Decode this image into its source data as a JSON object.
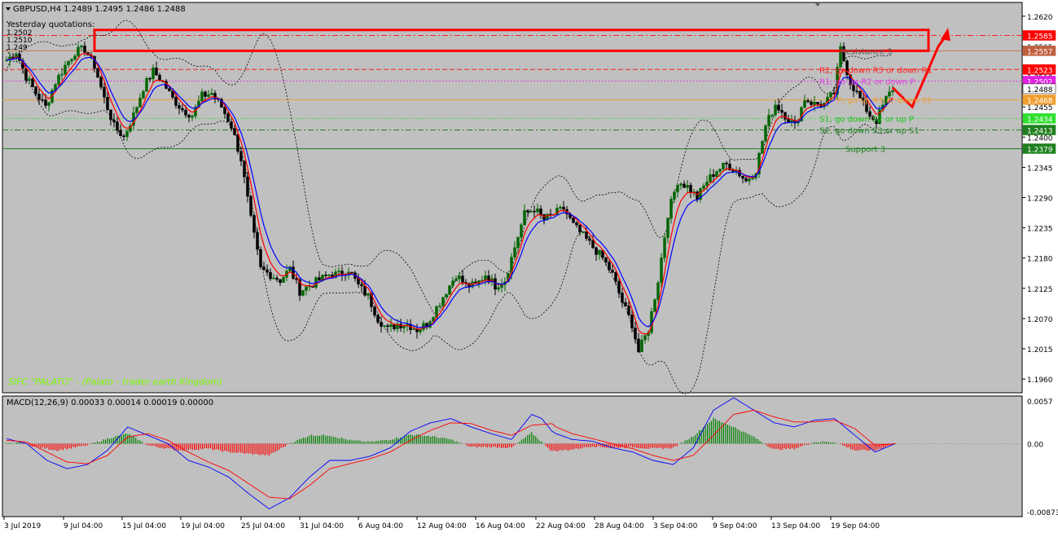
{
  "header": {
    "symbol_line": "GBPUSD,H4  1.2489 1.2495 1.2486 1.2488",
    "yesterday_label": "Yesterday quotations:",
    "quote_lines": [
      "1.2502",
      "1.2510",
      "1.249"
    ],
    "watermark": "SIFC \"PALATO\" - (Palato - trader earth Kingdom)"
  },
  "macd_label": "MACD(12,26,9) 0.00033 0.00014 0.00019 0.00000",
  "chart_data": [
    {
      "type": "candlestick",
      "symbol": "GBPUSD",
      "timeframe": "H4",
      "x_ticks": [
        "3 Jul 2019",
        "9 Jul 04:00",
        "15 Jul 04:00",
        "19 Jul 04:00",
        "25 Jul 04:00",
        "31 Jul 04:00",
        "6 Aug 04:00",
        "12 Aug 04:00",
        "16 Aug 04:00",
        "22 Aug 04:00",
        "28 Aug 04:00",
        "3 Sep 04:00",
        "9 Sep 04:00",
        "13 Sep 04:00",
        "19 Sep 04:00"
      ],
      "y_ticks": [
        "1.2620",
        "1.2565",
        "1.2510",
        "1.2455",
        "1.2400",
        "1.2345",
        "1.2290",
        "1.2235",
        "1.2180",
        "1.2125",
        "1.2070",
        "1.2015",
        "1.1960"
      ],
      "ylim": [
        1.1935,
        1.2645
      ],
      "close_path": [
        [
          0,
          1.254
        ],
        [
          3,
          1.2555
        ],
        [
          6,
          1.251
        ],
        [
          9,
          1.248
        ],
        [
          12,
          1.2455
        ],
        [
          15,
          1.25
        ],
        [
          18,
          1.253
        ],
        [
          21,
          1.2555
        ],
        [
          24,
          1.256
        ],
        [
          27,
          1.253
        ],
        [
          30,
          1.247
        ],
        [
          33,
          1.242
        ],
        [
          36,
          1.24
        ],
        [
          39,
          1.244
        ],
        [
          42,
          1.249
        ],
        [
          45,
          1.252
        ],
        [
          48,
          1.25
        ],
        [
          51,
          1.247
        ],
        [
          54,
          1.245
        ],
        [
          57,
          1.244
        ],
        [
          60,
          1.2475
        ],
        [
          63,
          1.248
        ],
        [
          66,
          1.2455
        ],
        [
          69,
          1.242
        ],
        [
          72,
          1.236
        ],
        [
          75,
          1.225
        ],
        [
          78,
          1.216
        ],
        [
          81,
          1.215
        ],
        [
          84,
          1.214
        ],
        [
          87,
          1.216
        ],
        [
          90,
          1.212
        ],
        [
          93,
          1.213
        ],
        [
          96,
          1.214
        ],
        [
          99,
          1.215
        ],
        [
          102,
          1.215
        ],
        [
          105,
          1.216
        ],
        [
          108,
          1.213
        ],
        [
          111,
          1.211
        ],
        [
          114,
          1.207
        ],
        [
          117,
          1.205
        ],
        [
          120,
          1.206
        ],
        [
          123,
          1.206
        ],
        [
          126,
          1.205
        ],
        [
          129,
          1.206
        ],
        [
          132,
          1.209
        ],
        [
          135,
          1.212
        ],
        [
          138,
          1.215
        ],
        [
          141,
          1.213
        ],
        [
          144,
          1.213
        ],
        [
          147,
          1.215
        ],
        [
          150,
          1.213
        ],
        [
          153,
          1.214
        ],
        [
          156,
          1.22
        ],
        [
          159,
          1.226
        ],
        [
          162,
          1.227
        ],
        [
          165,
          1.225
        ],
        [
          168,
          1.226
        ],
        [
          171,
          1.227
        ],
        [
          174,
          1.224
        ],
        [
          177,
          1.222
        ],
        [
          180,
          1.22
        ],
        [
          183,
          1.218
        ],
        [
          186,
          1.215
        ],
        [
          189,
          1.21
        ],
        [
          192,
          1.206
        ],
        [
          194,
          1.201
        ],
        [
          197,
          1.205
        ],
        [
          200,
          1.214
        ],
        [
          203,
          1.226
        ],
        [
          206,
          1.232
        ],
        [
          209,
          1.231
        ],
        [
          212,
          1.229
        ],
        [
          215,
          1.232
        ],
        [
          218,
          1.234
        ],
        [
          221,
          1.235
        ],
        [
          224,
          1.234
        ],
        [
          227,
          1.232
        ],
        [
          230,
          1.234
        ],
        [
          233,
          1.242
        ],
        [
          236,
          1.246
        ],
        [
          239,
          1.244
        ],
        [
          242,
          1.242
        ],
        [
          245,
          1.247
        ],
        [
          248,
          1.246
        ],
        [
          251,
          1.246
        ],
        [
          254,
          1.248
        ],
        [
          256,
          1.256
        ],
        [
          259,
          1.25
        ],
        [
          262,
          1.247
        ],
        [
          265,
          1.244
        ],
        [
          267,
          1.243
        ],
        [
          270,
          1.247
        ],
        [
          272,
          1.2488
        ]
      ],
      "price_levels": [
        {
          "label": "Resistance 3",
          "value": 1.2557,
          "color": "#c07a50",
          "style": "solid",
          "text_color": "#555555"
        },
        {
          "label": "R2, go down R3 or down R1",
          "value": 1.2523,
          "color": "#ff2020",
          "style": "dash",
          "text_color": "#ff2020"
        },
        {
          "label": "R1, go up R2 or down P",
          "value": 1.2502,
          "color": "#e040e0",
          "style": "dot",
          "text_color": "#e040e0"
        },
        {
          "label": "P, go up R1 or down S1",
          "value": 1.2468,
          "color": "#e8a040",
          "style": "solid",
          "text_color": "#e8a040"
        },
        {
          "label": "S1, go down S2 or up P",
          "value": 1.2434,
          "color": "#40e040",
          "style": "dot",
          "text_color": "#20c020"
        },
        {
          "label": "S2, go down S3 or up S1",
          "value": 1.2413,
          "color": "#208020",
          "style": "dashdot",
          "text_color": "#208020"
        },
        {
          "label": "Support 3",
          "value": 1.2379,
          "color": "#208020",
          "style": "solid",
          "text_color": "#208020"
        }
      ],
      "price_tags": [
        {
          "text": "1.2585",
          "value": 1.2585,
          "bg": "#ff0000",
          "fg": "#ffffff"
        },
        {
          "text": "1.2557",
          "value": 1.2557,
          "bg": "#c06040",
          "fg": "#ffffff"
        },
        {
          "text": "1.2523",
          "value": 1.2523,
          "bg": "#ff0000",
          "fg": "#ffffff"
        },
        {
          "text": "1.2502",
          "value": 1.2502,
          "bg": "#e020e0",
          "fg": "#ffffff"
        },
        {
          "text": "1.2488",
          "value": 1.2488,
          "bg": "#ffffff",
          "fg": "#000000"
        },
        {
          "text": "1.2468",
          "value": 1.2468,
          "bg": "#f0a030",
          "fg": "#ffffff"
        },
        {
          "text": "1.2434",
          "value": 1.2434,
          "bg": "#30e030",
          "fg": "#ffffff"
        },
        {
          "text": "1.2413",
          "value": 1.2413,
          "bg": "#208020",
          "fg": "#ffffff"
        },
        {
          "text": "1.2379",
          "value": 1.2379,
          "bg": "#208020",
          "fg": "#ffffff"
        }
      ],
      "top_line": {
        "value": 1.2585,
        "color": "#ff2020",
        "style": "dashdot"
      },
      "highlight_zone": {
        "x_from": 20,
        "x_to": 302,
        "y_low": 1.2557,
        "y_high": 1.2595,
        "color": "#ff0000"
      },
      "forecast_path": [
        [
          272,
          1.249
        ],
        [
          278,
          1.2455
        ],
        [
          286,
          1.2565
        ],
        [
          289,
          1.259
        ]
      ],
      "colors": {
        "background": "#c0c0c0",
        "bull": "#006400",
        "bear": "#000000",
        "ma_fast": "#ff0000",
        "ma_slow": "#0000ff",
        "bands": "#000000"
      }
    },
    {
      "type": "macd",
      "name": "MACD(12,26,9)",
      "y_ticks": [
        "0.0057",
        "0.00",
        "-0.00873"
      ],
      "ylim": [
        -0.00873,
        0.0057
      ],
      "macd_path": [
        [
          0,
          0.0006
        ],
        [
          10,
          0.0
        ],
        [
          20,
          -0.002
        ],
        [
          30,
          -0.003
        ],
        [
          40,
          -0.0025
        ],
        [
          50,
          -0.0008
        ],
        [
          60,
          0.002
        ],
        [
          70,
          0.001
        ],
        [
          80,
          0.0
        ],
        [
          90,
          -0.002
        ],
        [
          100,
          -0.0028
        ],
        [
          110,
          -0.004
        ],
        [
          120,
          -0.006
        ],
        [
          130,
          -0.0078
        ],
        [
          140,
          -0.0065
        ],
        [
          150,
          -0.004
        ],
        [
          160,
          -0.002
        ],
        [
          170,
          -0.002
        ],
        [
          180,
          -0.0015
        ],
        [
          190,
          -0.0005
        ],
        [
          200,
          0.0015
        ],
        [
          210,
          0.0025
        ],
        [
          220,
          0.003
        ],
        [
          230,
          0.002
        ],
        [
          240,
          0.0012
        ],
        [
          250,
          0.0005
        ],
        [
          260,
          0.0035
        ],
        [
          265,
          0.003
        ],
        [
          270,
          0.0015
        ],
        [
          272,
          0.0012
        ],
        [
          280,
          0.0005
        ],
        [
          290,
          0.0003
        ],
        [
          300,
          -0.0005
        ],
        [
          310,
          -0.001
        ],
        [
          320,
          -0.002
        ],
        [
          330,
          -0.0025
        ],
        [
          340,
          -0.0005
        ],
        [
          350,
          0.004
        ],
        [
          360,
          0.0055
        ],
        [
          370,
          0.004
        ],
        [
          380,
          0.0025
        ],
        [
          390,
          0.002
        ],
        [
          400,
          0.0028
        ],
        [
          410,
          0.003
        ],
        [
          420,
          0.001
        ],
        [
          425,
          0.0
        ],
        [
          430,
          -0.001
        ],
        [
          440,
          0.0
        ]
      ],
      "signal_path": [
        [
          0,
          0.0004
        ],
        [
          10,
          0.0002
        ],
        [
          20,
          -0.001
        ],
        [
          30,
          -0.0022
        ],
        [
          40,
          -0.0024
        ],
        [
          50,
          -0.0014
        ],
        [
          60,
          0.0008
        ],
        [
          70,
          0.0012
        ],
        [
          80,
          0.0004
        ],
        [
          90,
          -0.001
        ],
        [
          100,
          -0.0022
        ],
        [
          110,
          -0.0032
        ],
        [
          120,
          -0.0048
        ],
        [
          130,
          -0.0064
        ],
        [
          140,
          -0.0066
        ],
        [
          150,
          -0.005
        ],
        [
          160,
          -0.003
        ],
        [
          170,
          -0.0024
        ],
        [
          180,
          -0.0018
        ],
        [
          190,
          -0.001
        ],
        [
          200,
          0.0004
        ],
        [
          210,
          0.0016
        ],
        [
          220,
          0.0025
        ],
        [
          230,
          0.0024
        ],
        [
          240,
          0.0016
        ],
        [
          250,
          0.001
        ],
        [
          260,
          0.0022
        ],
        [
          270,
          0.0024
        ],
        [
          272,
          0.002
        ],
        [
          280,
          0.0012
        ],
        [
          290,
          0.0006
        ],
        [
          300,
          0.0
        ],
        [
          310,
          -0.0006
        ],
        [
          320,
          -0.0014
        ],
        [
          330,
          -0.002
        ],
        [
          340,
          -0.0014
        ],
        [
          350,
          0.001
        ],
        [
          360,
          0.0035
        ],
        [
          370,
          0.004
        ],
        [
          380,
          0.0032
        ],
        [
          390,
          0.0026
        ],
        [
          400,
          0.0026
        ],
        [
          410,
          0.0028
        ],
        [
          420,
          0.0018
        ],
        [
          425,
          0.0008
        ],
        [
          430,
          -0.0002
        ],
        [
          440,
          0.0
        ]
      ],
      "histogram": [
        [
          5,
          0.0002
        ],
        [
          15,
          -0.0004
        ],
        [
          25,
          -0.0008
        ],
        [
          40,
          -0.0002
        ],
        [
          50,
          0.0006
        ],
        [
          60,
          0.0012
        ],
        [
          70,
          -0.0002
        ],
        [
          85,
          -0.0008
        ],
        [
          100,
          -0.0006
        ],
        [
          110,
          -0.001
        ],
        [
          120,
          -0.0012
        ],
        [
          130,
          -0.0014
        ],
        [
          140,
          0.0
        ],
        [
          150,
          0.001
        ],
        [
          160,
          0.001
        ],
        [
          170,
          0.0004
        ],
        [
          180,
          0.0002
        ],
        [
          190,
          0.0005
        ],
        [
          200,
          0.0011
        ],
        [
          210,
          0.0009
        ],
        [
          220,
          0.0005
        ],
        [
          230,
          -0.0004
        ],
        [
          240,
          -0.0004
        ],
        [
          250,
          -0.0005
        ],
        [
          260,
          0.0013
        ],
        [
          270,
          -0.0009
        ],
        [
          280,
          -0.0007
        ],
        [
          290,
          -0.0003
        ],
        [
          300,
          -0.0005
        ],
        [
          310,
          -0.0004
        ],
        [
          320,
          -0.0006
        ],
        [
          330,
          -0.0005
        ],
        [
          340,
          0.0009
        ],
        [
          350,
          0.003
        ],
        [
          360,
          0.002
        ],
        [
          370,
          0.0008
        ],
        [
          380,
          -0.0007
        ],
        [
          390,
          -0.0006
        ],
        [
          400,
          0.0002
        ],
        [
          410,
          0.0002
        ],
        [
          420,
          -0.0008
        ],
        [
          430,
          -0.0008
        ],
        [
          440,
          0.0
        ]
      ],
      "colors": {
        "macd": "#0000ff",
        "signal": "#ff0000",
        "hist_up": "#008000",
        "hist_down": "#ff0000"
      }
    }
  ]
}
